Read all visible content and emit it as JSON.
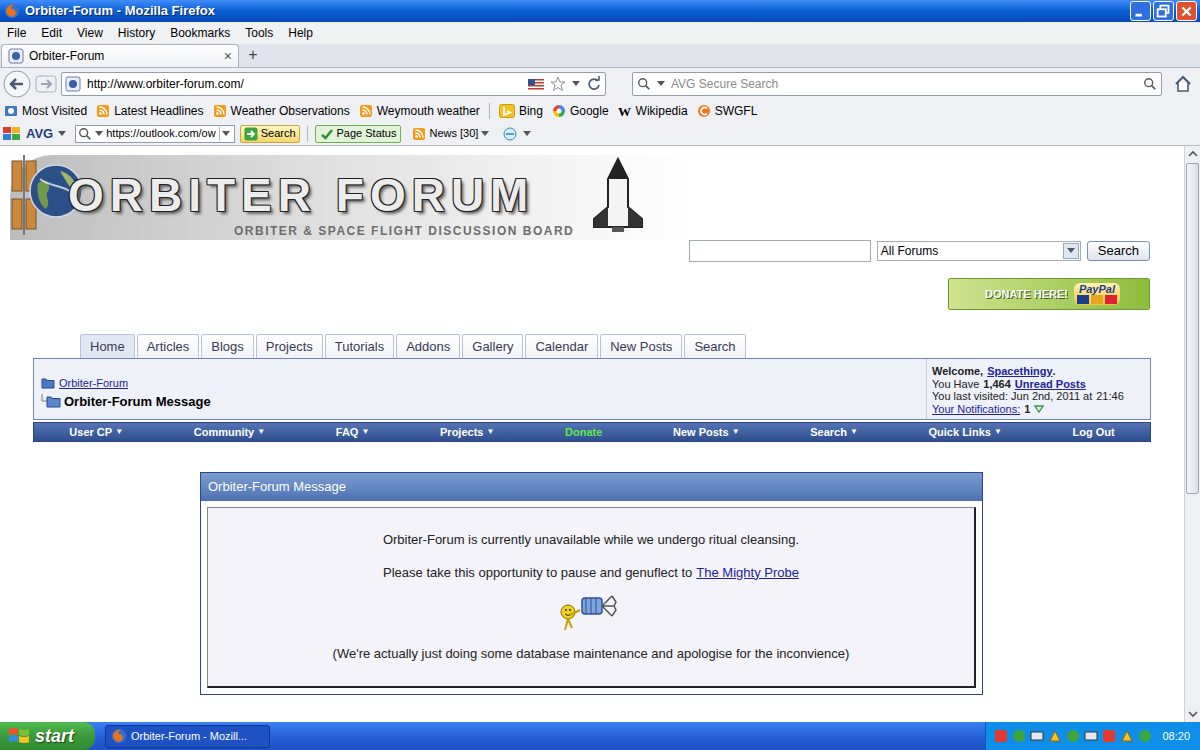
{
  "window": {
    "title": "Orbiter-Forum - Mozilla Firefox"
  },
  "menu": [
    "File",
    "Edit",
    "View",
    "History",
    "Bookmarks",
    "Tools",
    "Help"
  ],
  "tabs": [
    {
      "label": "Orbiter-Forum",
      "selected": true,
      "close": "×"
    }
  ],
  "new_tab": "+",
  "address": {
    "url": "http://www.orbiter-forum.com/",
    "search_placeholder": "AVG Secure Search"
  },
  "bookmarks": [
    {
      "label": "Most Visited",
      "kind": "folder"
    },
    {
      "label": "Latest Headlines",
      "kind": "feed"
    },
    {
      "label": "Weather Observations",
      "kind": "feed"
    },
    {
      "label": "Weymouth weather",
      "kind": "feed"
    },
    {
      "label": "Bing",
      "kind": "bing"
    },
    {
      "label": "Google",
      "kind": "google"
    },
    {
      "label": "Wikipedia",
      "kind": "wiki",
      "icon": "W"
    },
    {
      "label": "SWGFL",
      "kind": "swgfl"
    }
  ],
  "avg_toolbar": {
    "brand": "AVG",
    "field": "https://outlook.com/ow",
    "button": "Search",
    "page_status": "Page Status",
    "news": "News [30]"
  },
  "page": {
    "logo": {
      "title": "ORBITER FORUM",
      "subtitle": "ORBITER & SPACE FLIGHT DISCUSSION BOARD"
    },
    "search": {
      "select": "All Forums",
      "button": "Search"
    },
    "donate": {
      "label": "DONATE HERE!",
      "brand": "PayPal"
    },
    "nav_tabs": [
      {
        "label": "Home",
        "selected": true
      },
      {
        "label": "Articles",
        "selected": false
      },
      {
        "label": "Blogs",
        "selected": false
      },
      {
        "label": "Projects",
        "selected": false
      },
      {
        "label": "Tutorials",
        "selected": false
      },
      {
        "label": "Addons",
        "selected": false
      },
      {
        "label": "Gallery",
        "selected": false
      },
      {
        "label": "Calendar",
        "selected": false
      },
      {
        "label": "New Posts",
        "selected": false
      },
      {
        "label": "Search",
        "selected": false
      }
    ],
    "breadcrumb": {
      "root": "Orbiter-Forum",
      "current": "Orbiter-Forum Message"
    },
    "user_panel": {
      "welcome": "Welcome,",
      "username": "Spacethingy",
      "period": ".",
      "have": "You Have",
      "unread_count": "1,464",
      "unread_label": "Unread Posts",
      "last_visited": "You last visited: Jun 2nd, 2011 at",
      "last_time": "21:46",
      "notifications_label": "Your Notifications:",
      "notifications_count": "1"
    },
    "navbar": [
      {
        "label": "User CP",
        "arrow": "▼",
        "highlight": false
      },
      {
        "label": "Community",
        "arrow": "▼",
        "highlight": false
      },
      {
        "label": "FAQ",
        "arrow": "▼",
        "highlight": false
      },
      {
        "label": "Projects",
        "arrow": "▼",
        "highlight": false
      },
      {
        "label": "Donate",
        "highlight": true
      },
      {
        "label": "New Posts",
        "arrow": "▼",
        "highlight": false
      },
      {
        "label": "Search",
        "arrow": "▼",
        "highlight": false
      },
      {
        "label": "Quick Links",
        "arrow": "▼",
        "highlight": false
      },
      {
        "label": "Log Out",
        "highlight": false
      }
    ],
    "message": {
      "title": "Orbiter-Forum Message",
      "line1": "Orbiter-Forum is currently unavailable while we undergo ritual cleansing.",
      "line2": "Please take this opportunity to pause and genuflect to",
      "link": "The Mighty Probe",
      "note": "(We're actually just doing some database maintenance and apologise for the inconvience)"
    },
    "scrollbar": {
      "level": 0.61
    }
  },
  "taskbar": {
    "start": "start",
    "task": "Orbiter-Forum - Mozill...",
    "clock": "08:20"
  }
}
